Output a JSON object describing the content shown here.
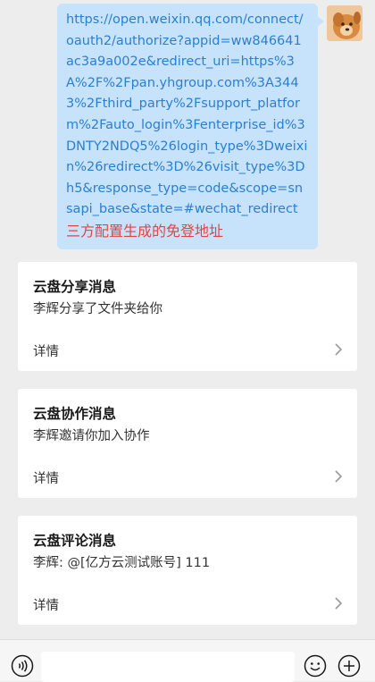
{
  "message": {
    "url_text": "https://open.weixin.qq.com/connect/oauth2/authorize?appid=ww846641ac3a9a002e&redirect_uri=https%3A%2F%2Fpan.yhgroup.com%3A3443%2Fthird_party%2Fsupport_platform%2Fauto_login%3Fenterprise_id%3DNTY2NDQ5%26login_type%3Dweixin%26redirect%3D%26visit_type%3Dh5&response_type=code&scope=snsapi_base&state=#wechat_redirect",
    "note": "三方配置生成的免登地址"
  },
  "cards": [
    {
      "title": "云盘分享消息",
      "desc": "李辉分享了文件夹给你",
      "detail": "详情"
    },
    {
      "title": "云盘协作消息",
      "desc": "李辉邀请你加入协作",
      "detail": "详情"
    },
    {
      "title": "云盘评论消息",
      "desc": "李辉: @[亿方云测试账号] 111",
      "detail": "详情"
    }
  ],
  "colors": {
    "background": "#ededed",
    "bubble": "#c7e3fb",
    "link": "#2a7fd2",
    "note": "#e64340",
    "card": "#ffffff"
  },
  "icons": {
    "voice": "voice-icon",
    "emoji": "emoji-icon",
    "plus": "plus-icon",
    "chevron": "chevron-right-icon"
  }
}
